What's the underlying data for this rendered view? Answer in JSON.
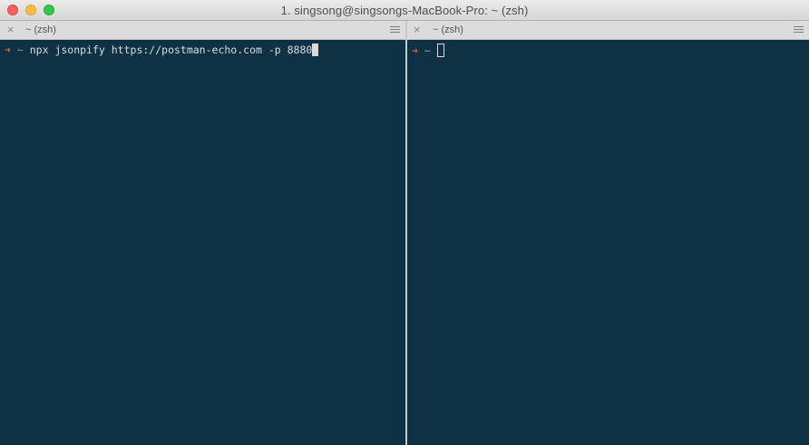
{
  "window": {
    "title": "1. singsong@singsongs-MacBook-Pro: ~ (zsh)"
  },
  "panes": [
    {
      "header_title": "~ (zsh)",
      "close_glyph": "×",
      "prompt_arrow": "➜",
      "prompt_dir": "~",
      "command": "npx jsonpify https://postman-echo.com -p 8880",
      "cursor_style": "block"
    },
    {
      "header_title": "~ (zsh)",
      "close_glyph": "×",
      "prompt_arrow": "➜",
      "prompt_dir": "~",
      "command": "",
      "cursor_style": "hollow"
    }
  ],
  "colors": {
    "terminal_bg": "#0e3243",
    "prompt_arrow": "#e8574a",
    "prompt_dir": "#7fa6b6",
    "text": "#d6dde0"
  },
  "icons": [
    "close-icon",
    "hamburger-menu-icon"
  ]
}
